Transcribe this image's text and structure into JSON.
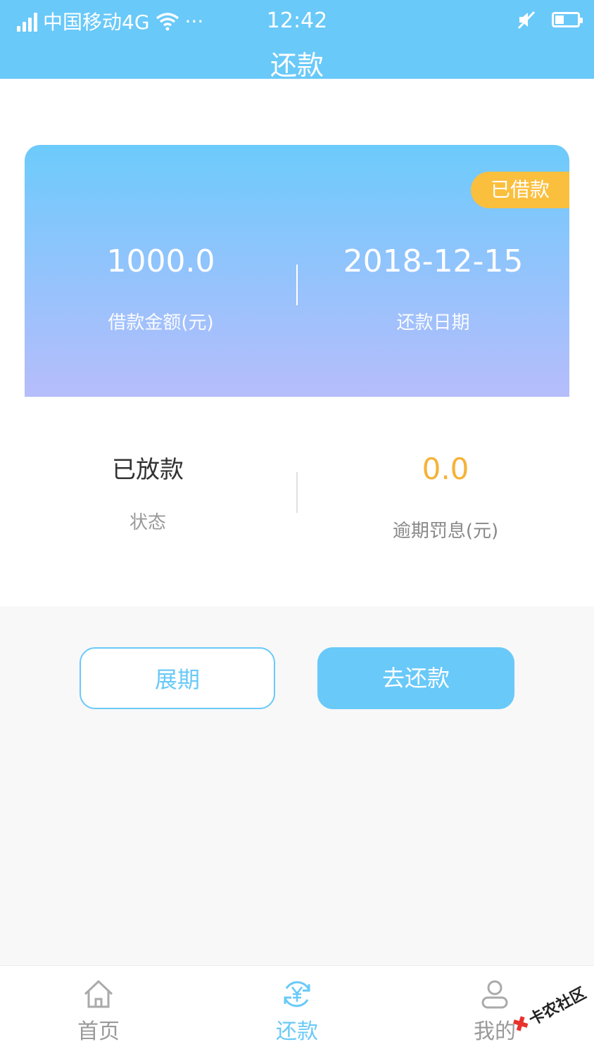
{
  "status_bar": {
    "carrier": "中国移动4G",
    "more": "···",
    "time": "12:42"
  },
  "header": {
    "title": "还款"
  },
  "loan_card": {
    "badge": "已借款",
    "amount": {
      "value": "1000.0",
      "label": "借款金额(元)"
    },
    "repay_date": {
      "value": "2018-12-15",
      "label": "还款日期"
    }
  },
  "info": {
    "status": {
      "value": "已放款",
      "label": "状态"
    },
    "penalty": {
      "value": "0.0",
      "label": "逾期罚息(元)"
    }
  },
  "actions": {
    "extend_label": "展期",
    "repay_label": "去还款"
  },
  "tabbar": {
    "items": [
      {
        "label": "首页",
        "icon": "home-icon",
        "active": false
      },
      {
        "label": "还款",
        "icon": "yuan-refresh-icon",
        "active": true
      },
      {
        "label": "我的",
        "icon": "user-icon",
        "active": false
      }
    ]
  },
  "watermark": {
    "text": "卡农社区"
  },
  "colors": {
    "primary": "#69c9f9",
    "badge": "#fbbf3e",
    "penalty": "#f6b237"
  }
}
